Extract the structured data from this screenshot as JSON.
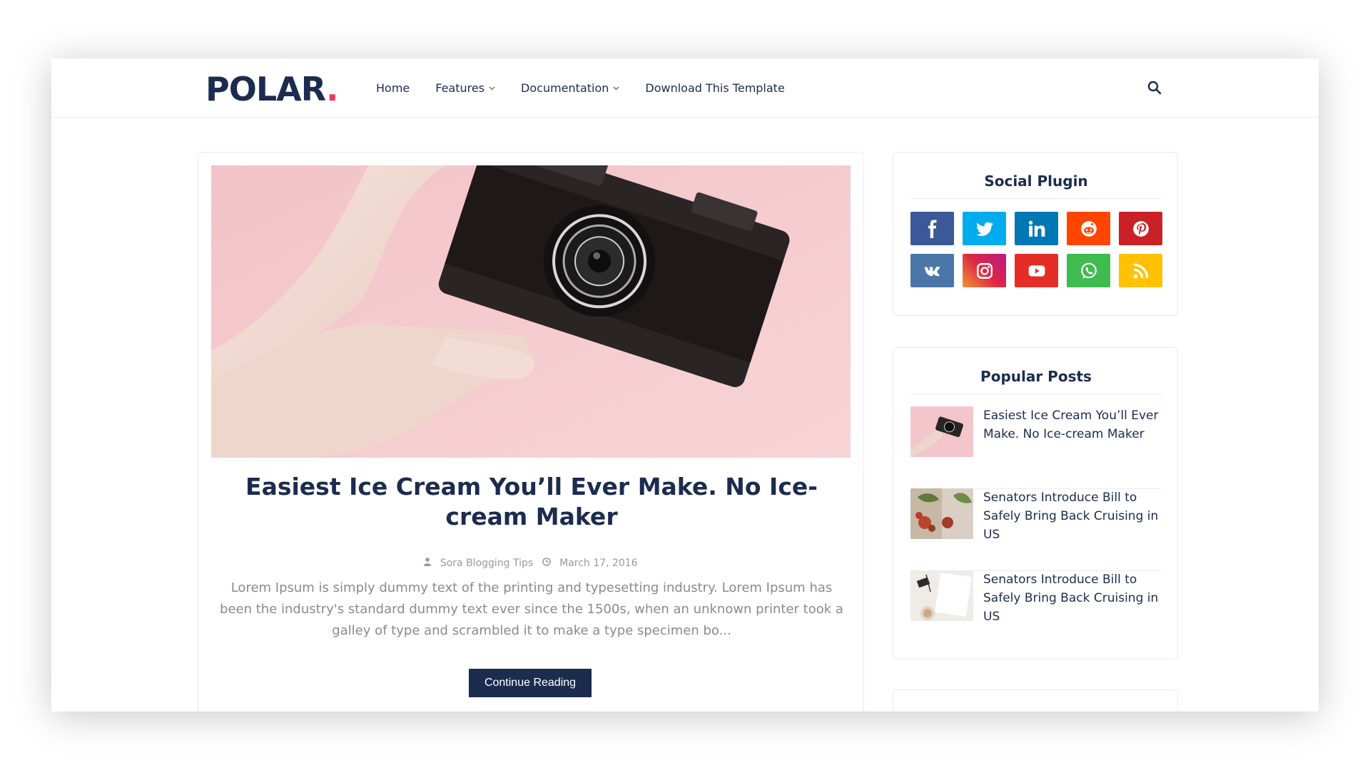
{
  "header": {
    "logo_text": "POLAR",
    "logo_dot": ".",
    "nav": [
      {
        "label": "Home",
        "dropdown": false
      },
      {
        "label": "Features",
        "dropdown": true
      },
      {
        "label": "Documentation",
        "dropdown": true
      },
      {
        "label": "Download This Template",
        "dropdown": false
      }
    ],
    "search_icon": "search-icon"
  },
  "post": {
    "title": "Easiest Ice Cream You’ll Ever Make. No Ice-cream Maker",
    "author": "Sora Blogging Tips",
    "date": "March 17, 2016",
    "excerpt": "Lorem Ipsum is simply dummy text of the printing and typesetting industry. Lorem Ipsum has been the industry's standard dummy text ever since the 1500s, when an unknown printer took a galley of type and scrambled it to make a type specimen bo...",
    "button_label": "Continue Reading"
  },
  "social": {
    "title": "Social Plugin",
    "items": [
      {
        "name": "facebook-icon",
        "color": "#3b5999"
      },
      {
        "name": "twitter-icon",
        "color": "#00acee"
      },
      {
        "name": "linkedin-icon",
        "color": "#0077b5"
      },
      {
        "name": "reddit-icon",
        "color": "#ff4500"
      },
      {
        "name": "pinterest-icon",
        "color": "#ca2127"
      },
      {
        "name": "vk-icon",
        "color": "#4a76a8"
      },
      {
        "name": "instagram-icon",
        "color": "#c13584"
      },
      {
        "name": "youtube-icon",
        "color": "#e52d27"
      },
      {
        "name": "whatsapp-icon",
        "color": "#3fbb50"
      },
      {
        "name": "rss-icon",
        "color": "#ffc200"
      }
    ]
  },
  "popular": {
    "title": "Popular Posts",
    "items": [
      {
        "title": "Easiest Ice Cream You’ll Ever Make. No Ice-cream Maker"
      },
      {
        "title": "Senators Introduce Bill to Safely Bring Back Cruising in US"
      },
      {
        "title": "Senators Introduce Bill to Safely Bring Back Cruising in US"
      }
    ]
  },
  "colors": {
    "brand": "#1c2c4e",
    "accent": "#f0375e"
  }
}
